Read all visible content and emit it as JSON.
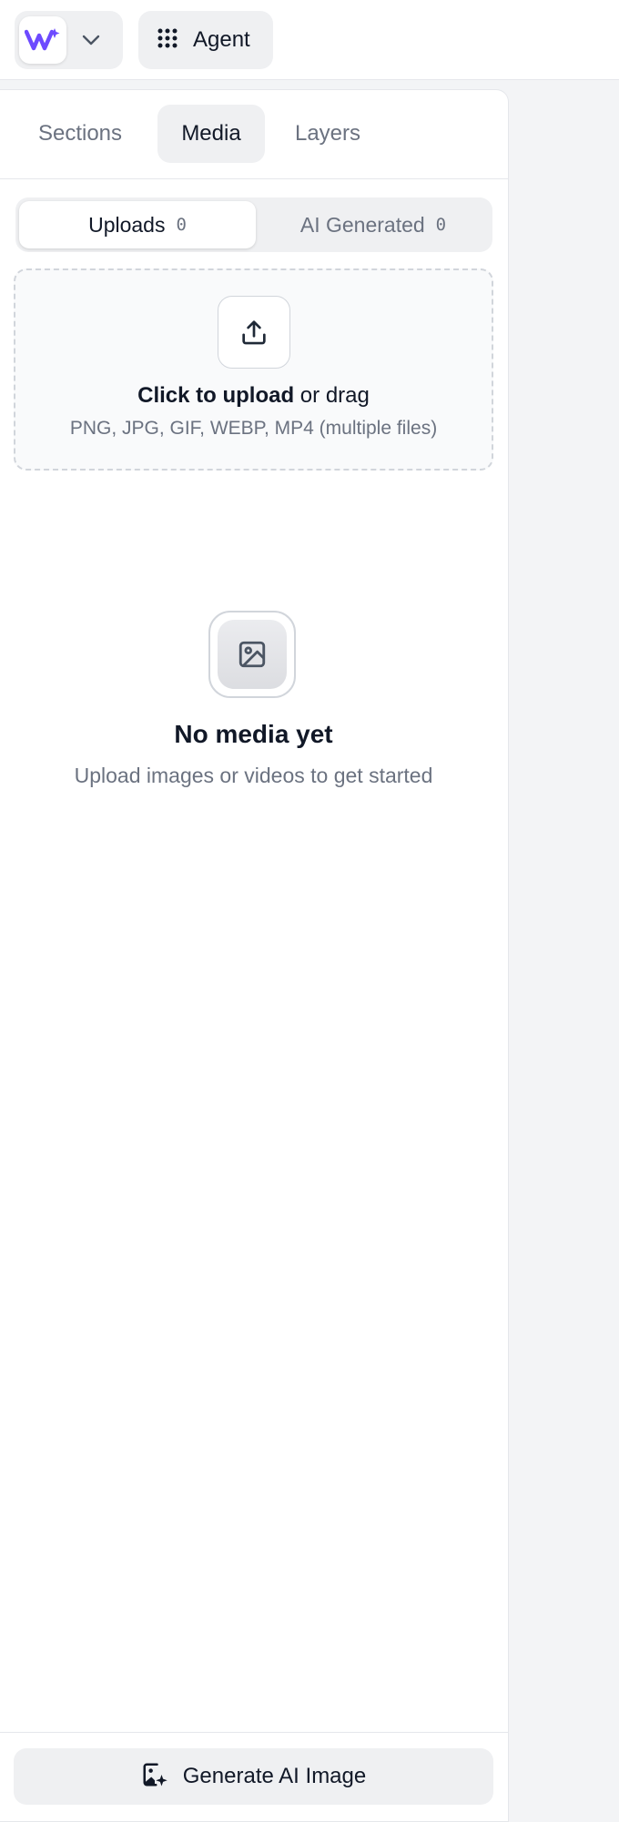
{
  "topbar": {
    "agent_label": "Agent",
    "brand_icon": "brand-logo-icon",
    "menu_icon": "grid-dots-icon",
    "chevron_icon": "chevron-down-icon",
    "brand_color": "#6d4aff"
  },
  "panel_tabs": [
    {
      "label": "Sections",
      "active": false
    },
    {
      "label": "Media",
      "active": true
    },
    {
      "label": "Layers",
      "active": false
    }
  ],
  "media_tabs": [
    {
      "label": "Uploads",
      "count": "0",
      "active": true
    },
    {
      "label": "AI Generated",
      "count": "0",
      "active": false
    }
  ],
  "dropzone": {
    "title_strong": "Click to upload",
    "title_rest": " or drag",
    "subtitle": "PNG, JPG, GIF, WEBP, MP4 (multiple files)",
    "icon": "upload-icon"
  },
  "empty_state": {
    "title": "No media yet",
    "subtitle": "Upload images or videos to get started",
    "icon": "image-icon"
  },
  "footer": {
    "generate_label": "Generate AI Image",
    "icon": "image-sparkle-icon"
  }
}
